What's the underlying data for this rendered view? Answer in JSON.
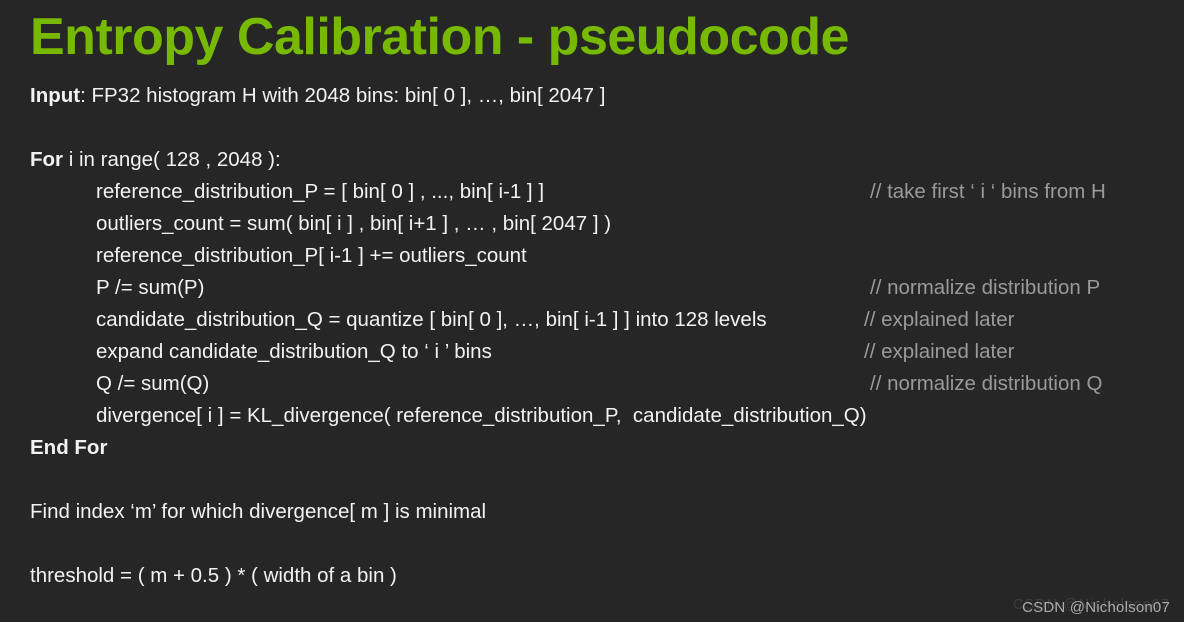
{
  "slide": {
    "title": "Entropy Calibration - pseudocode",
    "background_color": "#262626",
    "title_color": "#76b900",
    "text_color": "#f2f2f2",
    "comment_color": "#9a9a9a"
  },
  "code": {
    "lines": [
      {
        "text": "Input: FP32 histogram H with 2048 bins: bin[ 0 ], …, bin[ 2047 ]",
        "bold_prefix": "Input",
        "indent": false,
        "comment": ""
      },
      {
        "text": "",
        "indent": false,
        "comment": ""
      },
      {
        "text": "For i in range( 128 , 2048 ):",
        "bold_prefix": "For",
        "indent": false,
        "comment": ""
      },
      {
        "text": "reference_distribution_P = [ bin[ 0 ] , ..., bin[ i-1 ] ]",
        "indent": true,
        "comment": "// take first ‘ i ‘ bins from H"
      },
      {
        "text": "outliers_count = sum( bin[ i ] , bin[ i+1 ] , … , bin[ 2047 ] )",
        "indent": true,
        "comment": ""
      },
      {
        "text": "reference_distribution_P[ i-1 ] += outliers_count",
        "indent": true,
        "comment": ""
      },
      {
        "text": "P /= sum(P)",
        "indent": true,
        "comment": "// normalize distribution P"
      },
      {
        "text": "candidate_distribution_Q = quantize [ bin[ 0 ], …, bin[ i-1 ] ] into 128 levels",
        "indent": true,
        "comment": "// explained later"
      },
      {
        "text": "expand candidate_distribution_Q to ‘ i ’ bins",
        "indent": true,
        "comment": "// explained later"
      },
      {
        "text": "Q /= sum(Q)",
        "indent": true,
        "comment": "// normalize distribution Q"
      },
      {
        "text": "divergence[ i ] = KL_divergence( reference_distribution_P,  candidate_distribution_Q)",
        "indent": true,
        "comment": ""
      },
      {
        "text": "End For",
        "bold_all": true,
        "indent": false,
        "comment": ""
      },
      {
        "text": "",
        "indent": false,
        "comment": ""
      },
      {
        "text": "Find index ‘m’ for which divergence[ m ] is minimal",
        "indent": false,
        "comment": ""
      },
      {
        "text": "",
        "indent": false,
        "comment": ""
      },
      {
        "text": "threshold = ( m + 0.5 ) * ( width of a bin )",
        "indent": false,
        "comment": ""
      }
    ]
  },
  "watermark": {
    "text": "CSDN @Nicholson07",
    "ghost_text": "CSDN @Nicholson07"
  }
}
